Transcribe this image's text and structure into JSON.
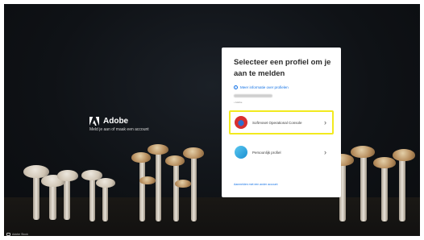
{
  "brand": {
    "name": "Adobe",
    "subtitle": "Meld je aan of maak een account"
  },
  "card": {
    "title": "Selecteer een profiel om je aan te melden",
    "info_link": "Meer informatie over profielen",
    "email_sub": "• Adobe",
    "profiles": [
      {
        "label": "SoftAsset Operational Console",
        "selected": true
      },
      {
        "label": "Persoonlijk profiel",
        "selected": false
      }
    ],
    "create_link": "Aanmelden met een ander account"
  },
  "footer": {
    "text": "Adobe Stock"
  },
  "colors": {
    "accent": "#1473e6",
    "highlight": "#f2ea1f",
    "background": "#0f1216"
  },
  "icons": [
    "adobe-logo-icon",
    "info-icon",
    "chevron-right-icon",
    "org-avatar-icon",
    "personal-avatar-icon"
  ]
}
